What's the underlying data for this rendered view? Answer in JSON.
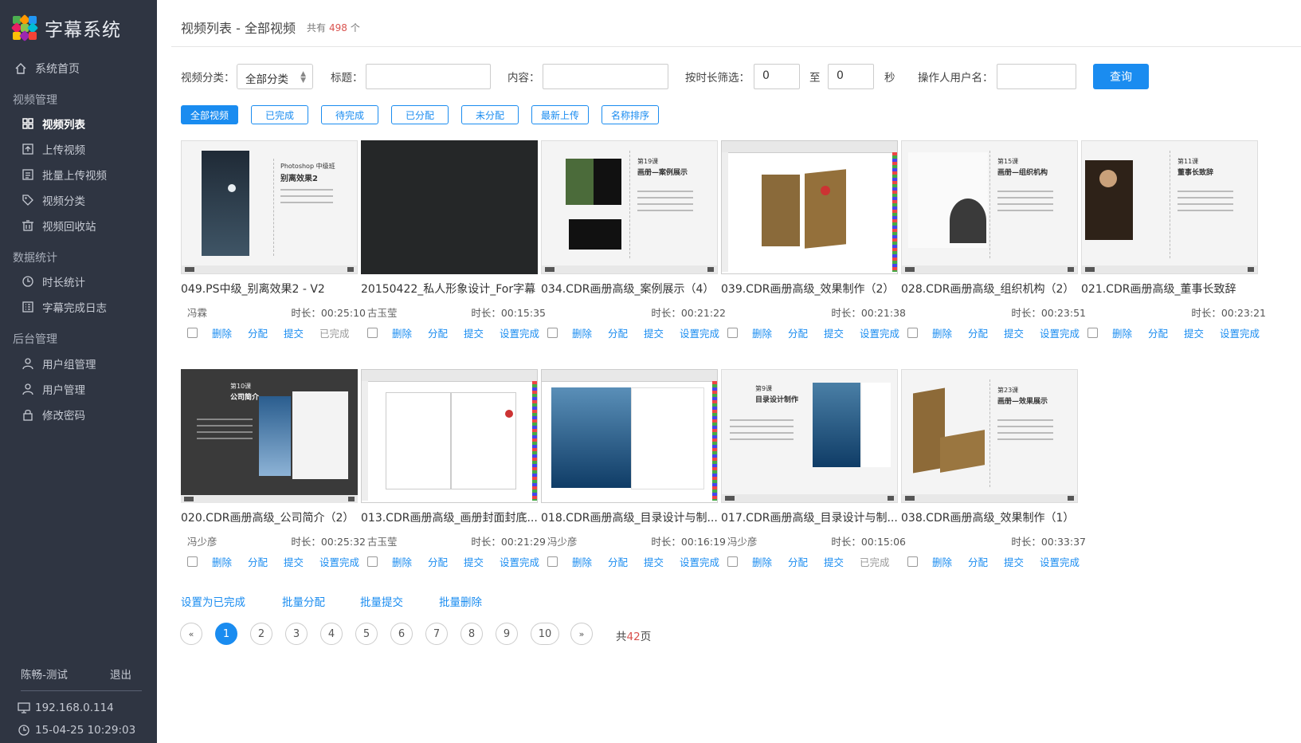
{
  "app": {
    "name": "字幕系统"
  },
  "sidebar": {
    "home": "系统首页",
    "groups": [
      {
        "label": "视频管理",
        "items": [
          "视频列表",
          "上传视频",
          "批量上传视频",
          "视频分类",
          "视频回收站"
        ]
      },
      {
        "label": "数据统计",
        "items": [
          "时长统计",
          "字幕完成日志"
        ]
      },
      {
        "label": "后台管理",
        "items": [
          "用户组管理",
          "用户管理",
          "修改密码"
        ]
      }
    ],
    "user": "陈畅-测试",
    "logout": "退出",
    "ip": "192.168.0.114",
    "time": "15-04-25 10:29:03"
  },
  "header": {
    "title": "视频列表 - 全部视频",
    "total_prefix": "共有",
    "total": "498",
    "total_suffix": "个"
  },
  "filters": {
    "category_label": "视频分类：",
    "category_value": "全部分类",
    "title_label": "标题：",
    "content_label": "内容：",
    "duration_label": "按时长筛选：",
    "duration_from": "0",
    "duration_to_label": "至",
    "duration_to": "0",
    "duration_unit": "秒",
    "operator_label": "操作人用户名：",
    "query_button": "查询"
  },
  "tabs": [
    "全部视频",
    "已完成",
    "待完成",
    "已分配",
    "未分配",
    "最新上传",
    "名称排序"
  ],
  "action_labels": {
    "delete": "删除",
    "assign": "分配",
    "submit": "提交",
    "set_done": "设置完成",
    "done": "已完成"
  },
  "videos": [
    {
      "title": "049.PS中级_别离效果2 - V2",
      "user": "冯霖",
      "duration": "时长：00:25:10",
      "status": "已完成",
      "done": true
    },
    {
      "title": "20150422_私人形象设计_For字幕",
      "user": "古玉莹",
      "duration": "时长：00:15:35",
      "status": "设置完成",
      "done": false
    },
    {
      "title": "034.CDR画册高级_案例展示（4）",
      "user": "",
      "duration": "时长：00:21:22",
      "status": "设置完成",
      "done": false
    },
    {
      "title": "039.CDR画册高级_效果制作（2）",
      "user": "",
      "duration": "时长：00:21:38",
      "status": "设置完成",
      "done": false
    },
    {
      "title": "028.CDR画册高级_组织机构（2）",
      "user": "",
      "duration": "时长：00:23:51",
      "status": "设置完成",
      "done": false
    },
    {
      "title": "021.CDR画册高级_董事长致辞",
      "user": "",
      "duration": "时长：00:23:21",
      "status": "设置完成",
      "done": false
    },
    {
      "title": "020.CDR画册高级_公司简介（2）",
      "user": "冯少彦",
      "duration": "时长：00:25:32",
      "status": "设置完成",
      "done": false
    },
    {
      "title": "013.CDR画册高级_画册封面封底...",
      "user": "古玉莹",
      "duration": "时长：00:21:29",
      "status": "设置完成",
      "done": false
    },
    {
      "title": "018.CDR画册高级_目录设计与制...",
      "user": "冯少彦",
      "duration": "时长：00:16:19",
      "status": "设置完成",
      "done": false
    },
    {
      "title": "017.CDR画册高级_目录设计与制...",
      "user": "冯少彦",
      "duration": "时长：00:15:06",
      "status": "已完成",
      "done": true
    },
    {
      "title": "038.CDR画册高级_效果制作（1）",
      "user": "",
      "duration": "时长：00:33:37",
      "status": "设置完成",
      "done": false
    }
  ],
  "thumb_text": {
    "ps_title": "Photoshop 中级班",
    "ps_sub": "别离效果2",
    "t19": "第19课",
    "t19b": "画册—案例展示",
    "t15": "第15课",
    "t15b": "画册—组织机构",
    "t11": "第11课",
    "t11b": "董事长致辞",
    "t10": "第10课",
    "t10b": "公司简介",
    "t9": "第9课",
    "t9b": "目录设计制作",
    "t23": "第23课",
    "t23b": "画册—效果展示"
  },
  "batch": [
    "设置为已完成",
    "批量分配",
    "批量提交",
    "批量删除"
  ],
  "pager": {
    "prev": "«",
    "pages": [
      "1",
      "2",
      "3",
      "4",
      "5",
      "6",
      "7",
      "8",
      "9",
      "10"
    ],
    "next": "»",
    "total_prefix": "共",
    "total": "42",
    "total_suffix": "页"
  }
}
